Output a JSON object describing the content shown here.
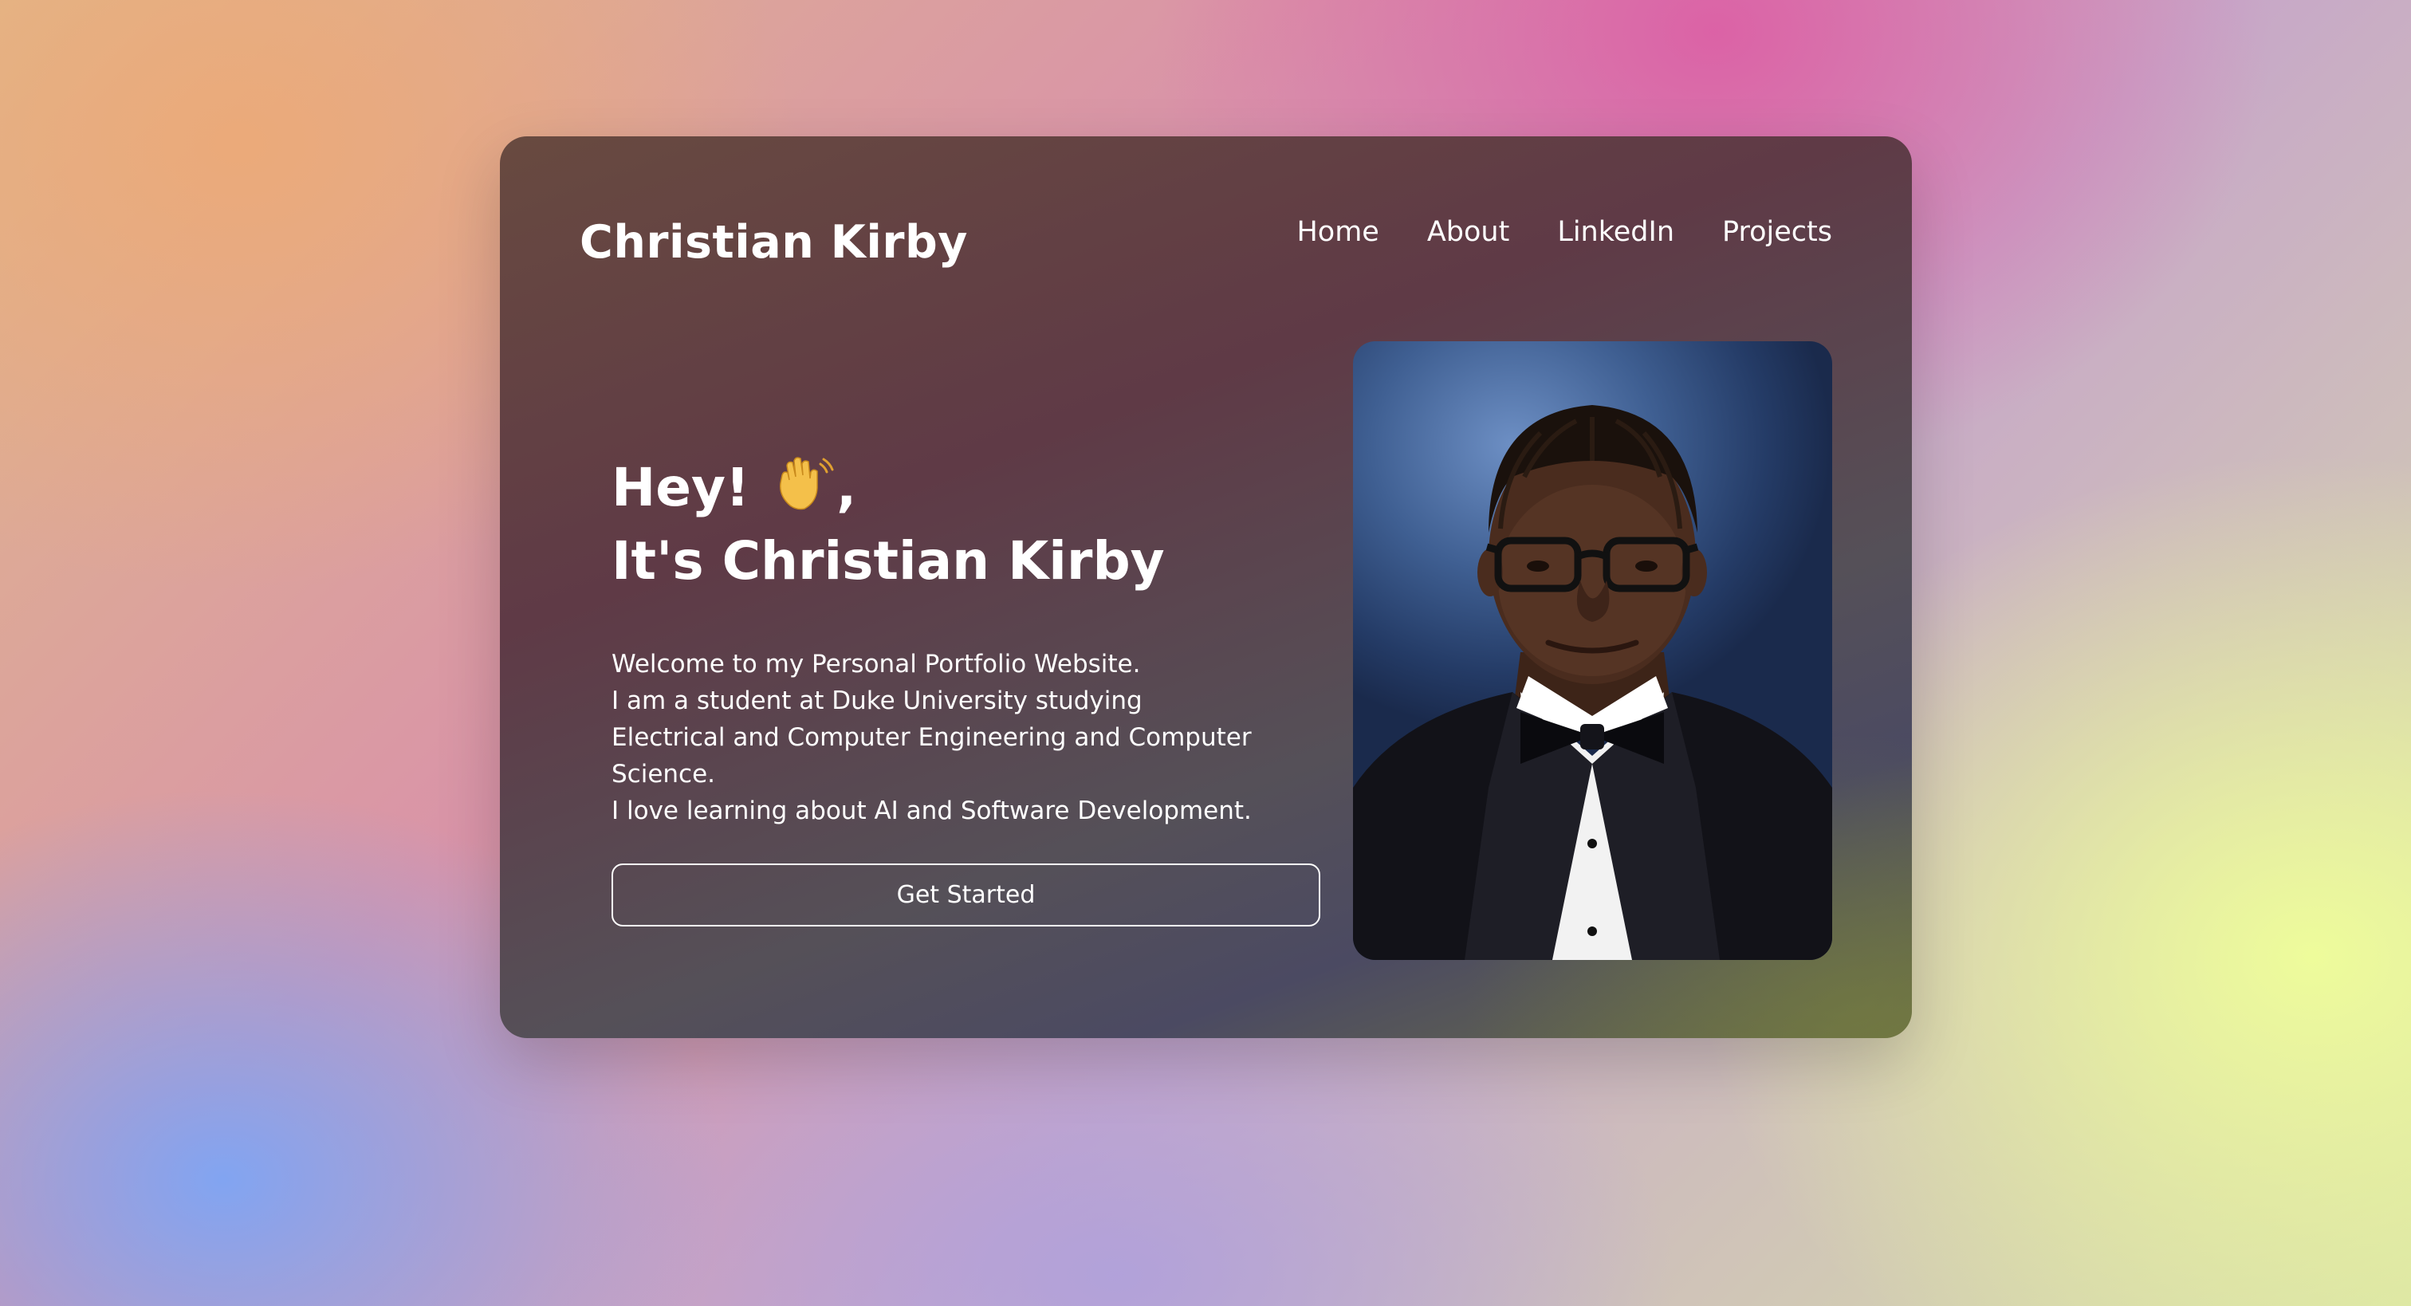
{
  "header": {
    "logo": "Christian Kirby",
    "nav": [
      "Home",
      "About",
      "LinkedIn",
      "Projects"
    ]
  },
  "hero": {
    "greeting": "Hey!",
    "greeting_suffix": ",",
    "name_line": "It's Christian Kirby",
    "intro_lines": [
      "Welcome to my Personal Portfolio Website.",
      "I am a student at Duke University studying",
      "Electrical and Computer Engineering and Computer Science.",
      "I love learning about AI and Software Development."
    ],
    "cta_label": "Get Started"
  },
  "icons": {
    "greeting_emoji": "waving-hand-icon"
  },
  "colors": {
    "text": "#ffffff",
    "card_top": "#684a40",
    "card_bottom": "#4b4a62"
  }
}
